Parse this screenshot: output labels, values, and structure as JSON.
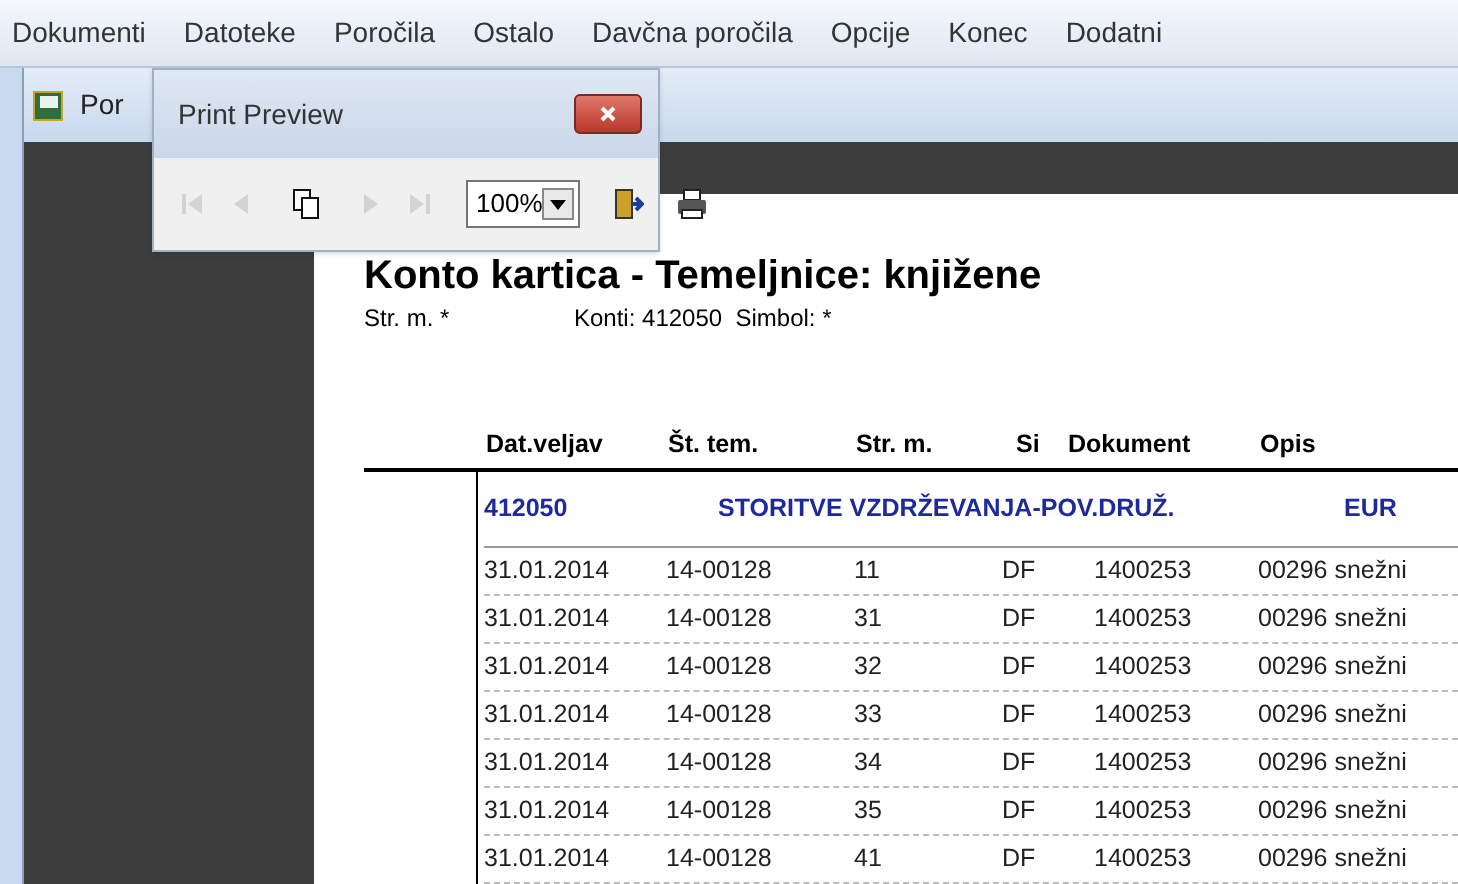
{
  "menu": [
    "Dokumenti",
    "Datoteke",
    "Poročila",
    "Ostalo",
    "Davčna poročila",
    "Opcije",
    "Konec",
    "Dodatni"
  ],
  "background_window": {
    "title": "Por"
  },
  "print_preview": {
    "title": "Print Preview",
    "zoom": "100%",
    "tools": [
      {
        "kind": "first",
        "disabled": true
      },
      {
        "kind": "prev",
        "disabled": true
      },
      {
        "kind": "sep"
      },
      {
        "kind": "pages",
        "disabled": false
      },
      {
        "kind": "sep"
      },
      {
        "kind": "next",
        "disabled": true
      },
      {
        "kind": "last",
        "disabled": true
      },
      {
        "kind": "sep"
      },
      {
        "kind": "zoom"
      },
      {
        "kind": "sep"
      },
      {
        "kind": "exit",
        "disabled": false
      },
      {
        "kind": "sep"
      },
      {
        "kind": "print",
        "disabled": false
      }
    ]
  },
  "report": {
    "title": "Konto kartica - Temeljnice: knjižene",
    "filter_1": "Str. m. *",
    "filter_2": "Konti: 412050  Simbol: *",
    "columns": [
      "Dat.veljav",
      "Št. tem.",
      "Str. m.",
      "Si",
      "Dokument",
      "Opis"
    ],
    "account": {
      "number": "412050",
      "name": "STORITVE VZDRŽEVANJA-POV.DRUŽ.",
      "currency": "EUR"
    },
    "rows": [
      [
        "31.01.2014",
        "14-00128",
        "11",
        "DF",
        "1400253",
        "00296 snežni"
      ],
      [
        "31.01.2014",
        "14-00128",
        "31",
        "DF",
        "1400253",
        "00296 snežni"
      ],
      [
        "31.01.2014",
        "14-00128",
        "32",
        "DF",
        "1400253",
        "00296 snežni"
      ],
      [
        "31.01.2014",
        "14-00128",
        "33",
        "DF",
        "1400253",
        "00296 snežni"
      ],
      [
        "31.01.2014",
        "14-00128",
        "34",
        "DF",
        "1400253",
        "00296 snežni"
      ],
      [
        "31.01.2014",
        "14-00128",
        "35",
        "DF",
        "1400253",
        "00296 snežni"
      ],
      [
        "31.01.2014",
        "14-00128",
        "41",
        "DF",
        "1400253",
        "00296 snežni"
      ]
    ]
  }
}
